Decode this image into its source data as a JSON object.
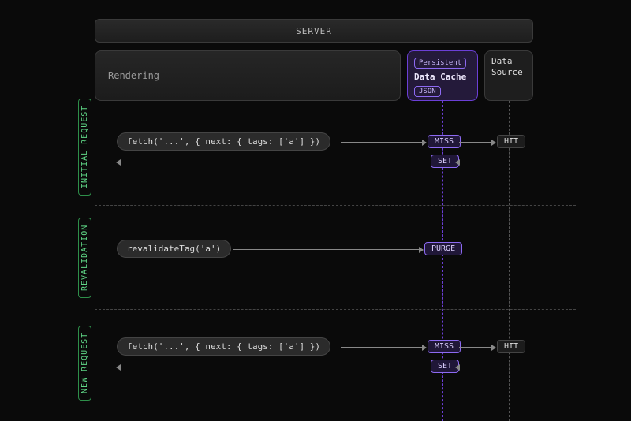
{
  "header": {
    "server": "SERVER",
    "rendering": "Rendering",
    "cache": {
      "persistent": "Persistent",
      "title": "Data Cache",
      "format": "JSON"
    },
    "source": "Data\nSource"
  },
  "sections": {
    "initial": {
      "label": "INITIAL REQUEST",
      "fetch": "fetch('...', { next: { tags: ['a'] })",
      "miss": "MISS",
      "hit": "HIT",
      "set": "SET"
    },
    "revalidation": {
      "label": "REVALIDATION",
      "call": "revalidateTag('a')",
      "purge": "PURGE"
    },
    "newreq": {
      "label": "NEW REQUEST",
      "fetch": "fetch('...', { next: { tags: ['a'] })",
      "miss": "MISS",
      "hit": "HIT",
      "set": "SET"
    }
  }
}
